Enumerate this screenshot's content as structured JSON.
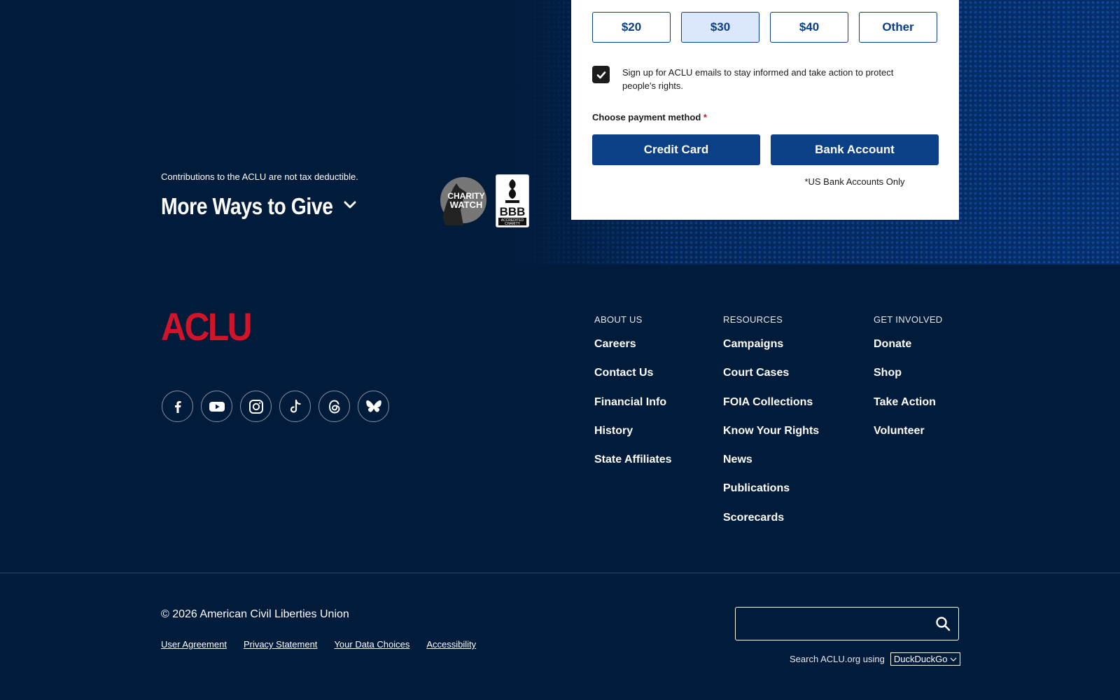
{
  "donation": {
    "amounts": [
      {
        "label": "$20"
      },
      {
        "label": "$30"
      },
      {
        "label": "$40"
      },
      {
        "label": "Other"
      }
    ],
    "selected_amount": "$30",
    "email_optin_text": "Sign up for ACLU emails to stay informed and take action to protect people's rights.",
    "email_optin_checked": true,
    "payment_label": "Choose payment method",
    "required_mark": "*",
    "credit_card_label": "Credit Card",
    "bank_account_label": "Bank Account",
    "bank_note": "*US Bank Accounts Only"
  },
  "give": {
    "tax_note": "Contributions to the ACLU are not tax deductible.",
    "more_ways_title": "More Ways to Give",
    "charity_watch_text_1": "CHARITY",
    "charity_watch_text_2": "WATCH",
    "bbb_text": "BBB",
    "bbb_sub_1": "ACCREDITED",
    "bbb_sub_2": "CHARITY"
  },
  "footer": {
    "logo_text": "ACLU",
    "brand_red": "#d0142a",
    "socials": [
      "facebook-icon",
      "youtube-icon",
      "instagram-icon",
      "tiktok-icon",
      "threads-icon",
      "bluesky-icon"
    ],
    "columns": [
      {
        "heading": "ABOUT US",
        "links": [
          "Careers",
          "Contact Us",
          "Financial Info",
          "History",
          "State Affiliates"
        ]
      },
      {
        "heading": "RESOURCES",
        "links": [
          "Campaigns",
          "Court Cases",
          "FOIA Collections",
          "Know Your Rights",
          "News",
          "Publications",
          "Scorecards"
        ]
      },
      {
        "heading": "GET INVOLVED",
        "links": [
          "Donate",
          "Shop",
          "Take Action",
          "Volunteer"
        ]
      }
    ]
  },
  "bottom": {
    "copyright": "© 2026 American Civil Liberties Union",
    "legal_links": [
      "User Agreement",
      "Privacy Statement",
      "Your Data Choices",
      "Accessibility"
    ],
    "search_value": "",
    "search_using_label": "Search ACLU.org using",
    "search_engine": "DuckDuckGo"
  },
  "colors": {
    "navy": "#011b3b",
    "button_blue": "#0b3f86",
    "selected_bg": "#dbe8fb"
  }
}
